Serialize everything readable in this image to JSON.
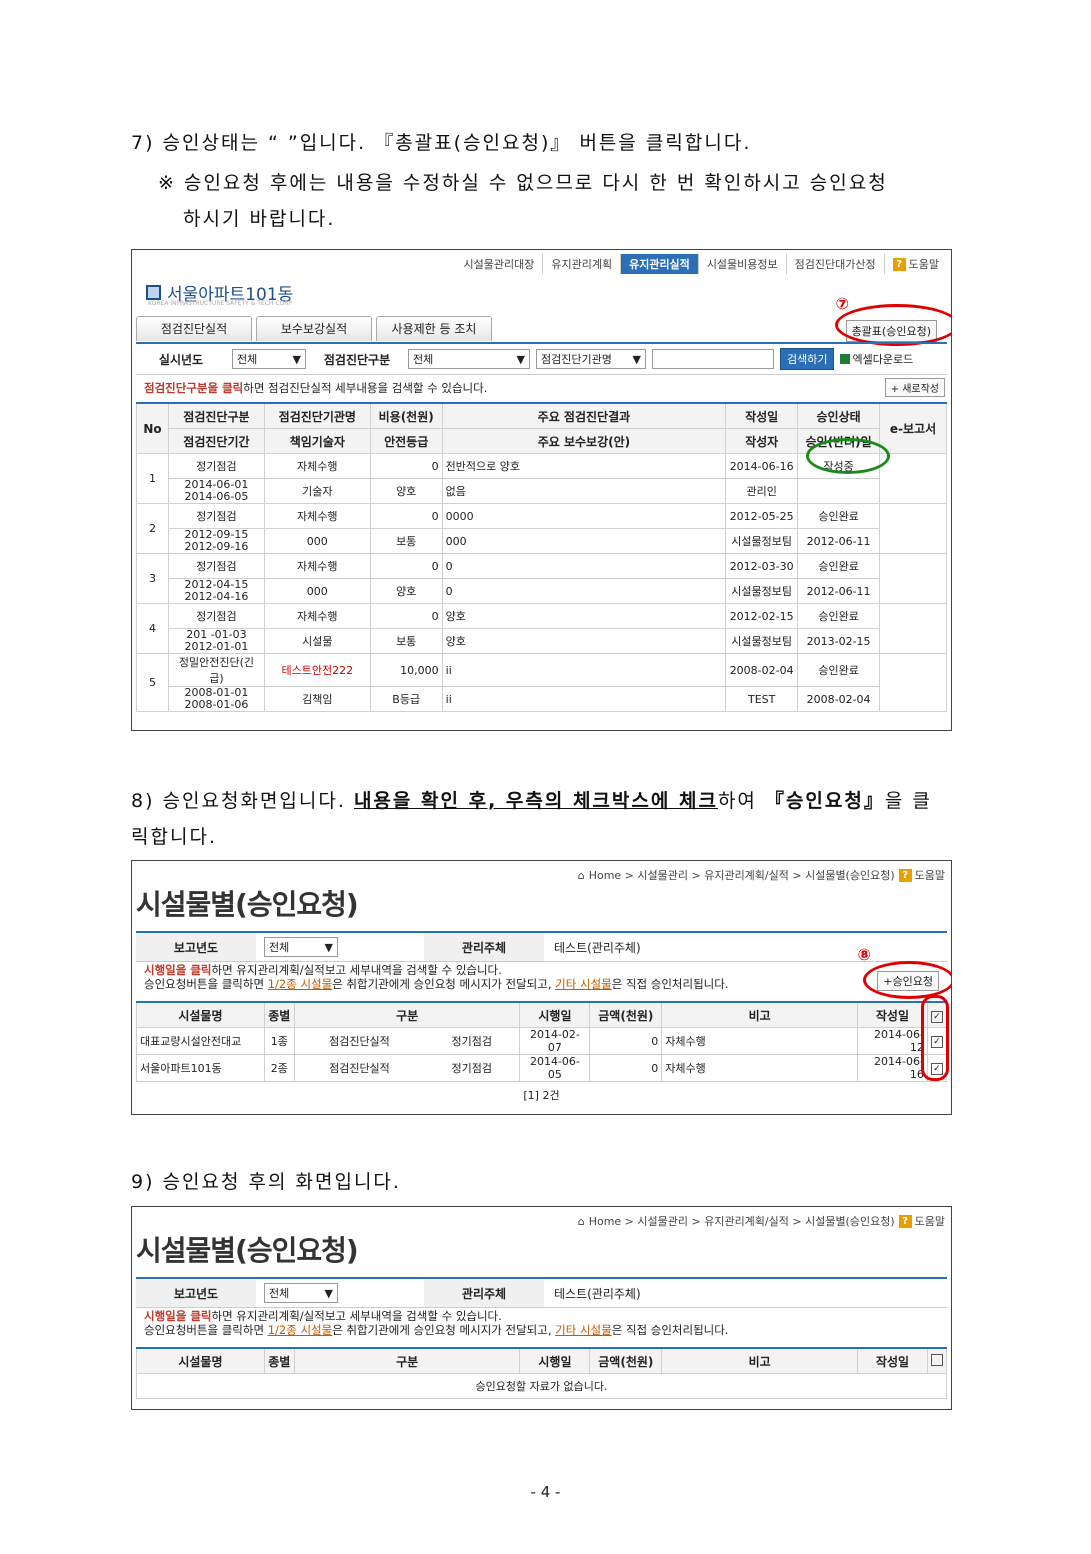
{
  "step7": {
    "line1": "7)      승인상태는 “       ”입니다. 『총괄표(승인요청)』 버튼을 클릭합니다.",
    "line2": "※ 승인요청 후에는 내용을 수정하실 수 없으므로 다시 한 번 확인하시고 승인요청",
    "line3": "하시기 바랍니다."
  },
  "shot1": {
    "nav": [
      "시설물관리대장",
      "유지관리계획",
      "유지관리실적",
      "시설물비용정보",
      "점검진단대가산정"
    ],
    "help": "도움말",
    "site": "서울아파트101동",
    "site_sub": "KOREA INFRASTRUCTURE SAFETY & TECH CORP",
    "tabs": [
      "점검진단실적",
      "보수보강실적",
      "사용제한 등 조치"
    ],
    "summary_btn": "총괄표(승인요청)",
    "marker": "⑦",
    "filter_year_label": "실시년도",
    "filter_year": "전체",
    "filter_type_label": "점검진단구분",
    "filter_type": "전체",
    "filter_agency": "점검진단기관명",
    "search_btn": "검색하기",
    "excel": "엑셀다운로드",
    "hint_strong": "점검진단구분을 클릭",
    "hint_rest": "하면 점검진단실적 세부내용을 검색할 수 있습니다.",
    "new_btn": "+ 새로작성",
    "headers": {
      "no": "No",
      "h1a": "점검진단구분",
      "h1b": "점검진단기간",
      "h2a": "점검진단기관명",
      "h2b": "책임기술자",
      "h3a": "비용(천원)",
      "h3b": "안전등급",
      "h4a": "주요 점검진단결과",
      "h4b": "주요 보수보강(안)",
      "h5a": "작성일",
      "h5b": "작성자",
      "h6a": "승인상태",
      "h6b": "승인(반려)일",
      "h7": "e-보고서"
    },
    "rows": [
      {
        "no": "1",
        "type": "정기점검",
        "period": "2014-06-01\n2014-06-05",
        "agency": "자체수행",
        "engineer": "기술자",
        "cost": "0",
        "grade": "양호",
        "result": "전반적으로 양호",
        "repair": "없음",
        "date": "2014-06-16",
        "author": "관리인",
        "status": "작성중",
        "appr": ""
      },
      {
        "no": "2",
        "type": "정기점검",
        "period": "2012-09-15\n2012-09-16",
        "agency": "자체수행",
        "engineer": "000",
        "cost": "0",
        "grade": "보통",
        "result": "0000",
        "repair": "000",
        "date": "2012-05-25",
        "author": "시설물정보팀",
        "status": "승인완료",
        "appr": "2012-06-11"
      },
      {
        "no": "3",
        "type": "정기점검",
        "period": "2012-04-15\n2012-04-16",
        "agency": "자체수행",
        "engineer": "000",
        "cost": "0",
        "grade": "양호",
        "result": "0",
        "repair": "0",
        "date": "2012-03-30",
        "author": "시설물정보팀",
        "status": "승인완료",
        "appr": "2012-06-11"
      },
      {
        "no": "4",
        "type": "정기점검",
        "period": "201 -01-03\n2012-01-01",
        "agency": "자체수행",
        "engineer": "시설물",
        "cost": "0",
        "grade": "보통",
        "result": "양호",
        "repair": "양호",
        "date": "2012-02-15",
        "author": "시설물정보팀",
        "status": "승인완료",
        "appr": "2013-02-15"
      },
      {
        "no": "5",
        "type": "정밀안전진단(긴급)",
        "period": "2008-01-01\n2008-01-06",
        "agency": "테스트안전222",
        "engineer": "김책임",
        "cost": "10,000",
        "grade": "B등급",
        "result": "ii",
        "repair": "ii",
        "date": "2008-02-04",
        "author": "TEST",
        "status": "승인완료",
        "appr": "2008-02-04"
      }
    ]
  },
  "step8": {
    "prefix": "8) 승인요청화면입니다. ",
    "underline": "내용을 확인 후, 우측의 체크박스에 체크",
    "mid": "하여 ",
    "bold": "『승인요청』",
    "suffix": "을 클",
    "line2": "릭합니다."
  },
  "shot2": {
    "crumb": "Home > 시설물관리 > 유지관리계획/실적 > 시설물별(승인요청)",
    "help": "도움말",
    "title": "시설물별(승인요청)",
    "year_label": "보고년도",
    "year": "전체",
    "owner_label": "관리주체",
    "owner": "테스트(관리주체)",
    "note1_red": "시행일을 클릭",
    "note1_rest": "하면 유지관리계획/실적보고 세부내역을 검색할 수 있습니다.",
    "note2_a": "승인요청버튼을 클릭하면 ",
    "note2_l1": "1/2종 시설물",
    "note2_b": "은 취합기관에게 승인요청 메시지가 전달되고, ",
    "note2_l2": "기타 시설물",
    "note2_c": "은 직접 승인처리됩니다.",
    "marker": "⑧",
    "request_btn": "+승인요청",
    "headers": [
      "시설물명",
      "종별",
      "구분",
      "시행일",
      "금액(천원)",
      "비고",
      "작성일"
    ],
    "rows": [
      {
        "name": "대표교량시설안전대교",
        "kind": "1종",
        "cat1": "점검진단실적",
        "cat2": "정기점검",
        "date": "2014-02-07",
        "amount": "0",
        "memo": "자체수행",
        "written": "2014-06-12"
      },
      {
        "name": "서울아파트101동",
        "kind": "2종",
        "cat1": "점검진단실적",
        "cat2": "정기점검",
        "date": "2014-06-05",
        "amount": "0",
        "memo": "자체수행",
        "written": "2014-06-16"
      }
    ],
    "pager": "[1]    2건"
  },
  "step9": {
    "text": "9) 승인요청 후의 화면입니다."
  },
  "shot3": {
    "crumb": "Home > 시설물관리 > 유지관리계획/실적 > 시설물별(승인요청)",
    "help": "도움말",
    "title": "시설물별(승인요청)",
    "year_label": "보고년도",
    "year": "전체",
    "owner_label": "관리주체",
    "owner": "테스트(관리주체)",
    "headers": [
      "시설물명",
      "종별",
      "구분",
      "시행일",
      "금액(천원)",
      "비고",
      "작성일"
    ],
    "empty": "승인요청할 자료가 없습니다."
  },
  "page_number": "- 4 -"
}
